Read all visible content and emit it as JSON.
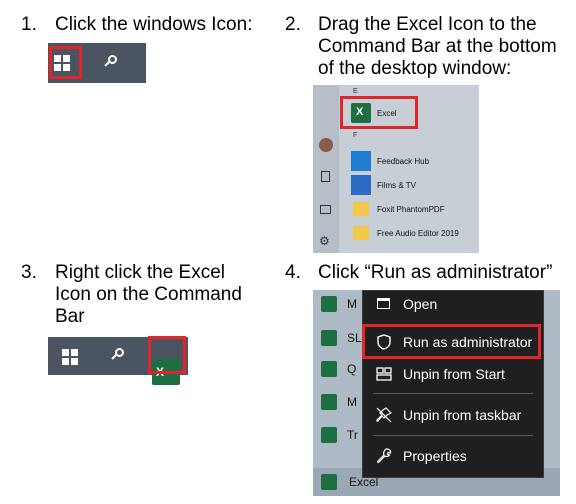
{
  "steps": [
    {
      "number": "1.",
      "lines": [
        "Click the windows Icon:"
      ]
    },
    {
      "number": "2.",
      "lines": [
        "Drag the Excel Icon to the",
        "Command Bar at the bottom",
        "of the desktop window:"
      ]
    },
    {
      "number": "3.",
      "lines": [
        "Right click the Excel",
        "Icon on the Command",
        "Bar"
      ]
    },
    {
      "number": "4.",
      "lines": [
        "Click “Run as administrator”"
      ]
    }
  ],
  "start_menu": {
    "letter_e": "E",
    "letter_f": "F",
    "items": [
      {
        "label": "Excel",
        "icon": "excel-icon"
      },
      {
        "label": "Feedback Hub",
        "icon": "feedback-hub-icon"
      },
      {
        "label": "Films & TV",
        "icon": "films-tv-icon"
      },
      {
        "label": "Foxit PhantomPDF",
        "icon": "folder-icon"
      },
      {
        "label": "Free Audio Editor 2019",
        "icon": "folder-icon"
      }
    ]
  },
  "context_menu": {
    "items": [
      {
        "label": "Open",
        "icon": "open-window-icon"
      },
      {
        "label": "Run as administrator",
        "icon": "shield-icon"
      },
      {
        "label": "Unpin from Start",
        "icon": "unpin-start-icon"
      },
      {
        "label": "Unpin from taskbar",
        "icon": "unpin-taskbar-icon"
      },
      {
        "label": "Properties",
        "icon": "wrench-icon"
      }
    ],
    "background_rows": [
      "M",
      "SL",
      "Q",
      "M",
      "Tr"
    ],
    "bottom_label": "Excel"
  },
  "excel_glyph": "X",
  "colors": {
    "highlight": "#e0262b",
    "taskbar": "#4a5561",
    "excel_green": "#1d6f42",
    "menu_bg": "#1f1f1f"
  }
}
